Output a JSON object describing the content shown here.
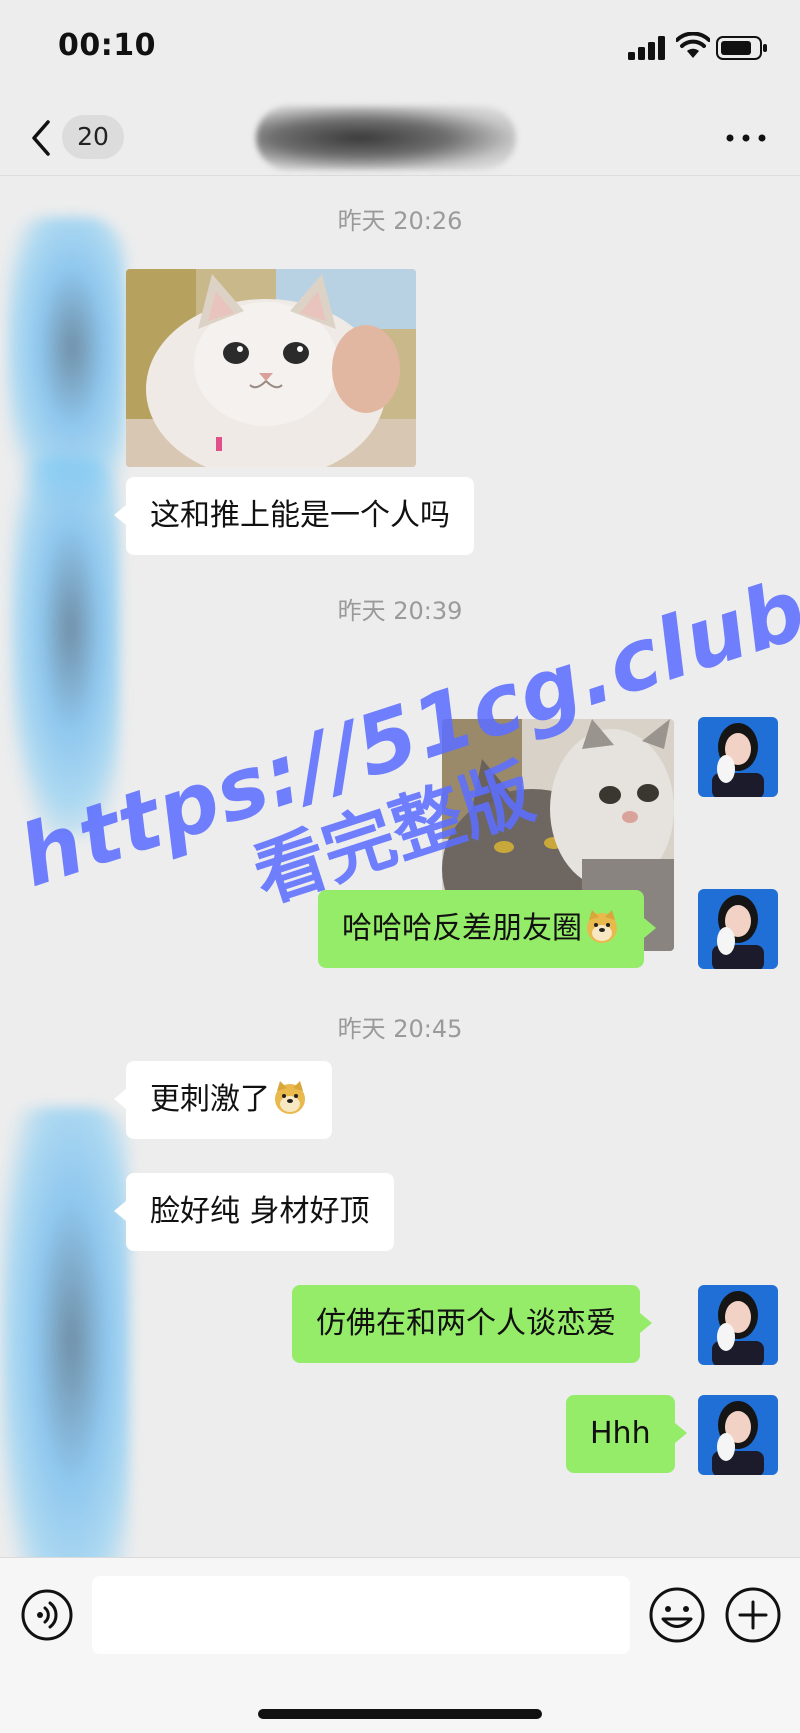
{
  "status_bar": {
    "time": "00:10"
  },
  "nav": {
    "back_label": "",
    "unread_count": "20"
  },
  "chat": {
    "messages": [
      {
        "timestamp": "昨天 20:26"
      },
      {
        "side": "left",
        "type": "image",
        "image": "cat photo"
      },
      {
        "side": "left",
        "type": "text",
        "text": "这和推上能是一个人吗"
      },
      {
        "timestamp": "昨天 20:39"
      },
      {
        "side": "right",
        "type": "image",
        "image": "two cats photo"
      },
      {
        "side": "right",
        "type": "text",
        "text": "哈哈哈反差朋友圈"
      },
      {
        "timestamp": "昨天 20:45"
      },
      {
        "side": "left",
        "type": "text",
        "text": "更刺激了"
      },
      {
        "side": "left",
        "type": "text",
        "text": "脸好纯 身材好顶"
      },
      {
        "side": "right",
        "type": "text",
        "text": "仿佛在和两个人谈恋爱"
      },
      {
        "side": "right",
        "type": "text",
        "text": "Hhh"
      }
    ]
  },
  "watermark": {
    "url": "https://51cg.club",
    "cta": "看完整版"
  },
  "input": {
    "placeholder": ""
  },
  "icons": {
    "back": "chevron-left-icon",
    "more": "more-dots-icon",
    "voice": "voice-icon",
    "emoji": "emoji-smile-icon",
    "plus": "plus-icon",
    "sticker": "doge-emoji"
  },
  "colors": {
    "background": "#ededed",
    "sent_bubble": "#95ec69",
    "received_bubble": "#ffffff",
    "timestamp": "#9a9a9a",
    "watermark": "#5c6eff"
  }
}
